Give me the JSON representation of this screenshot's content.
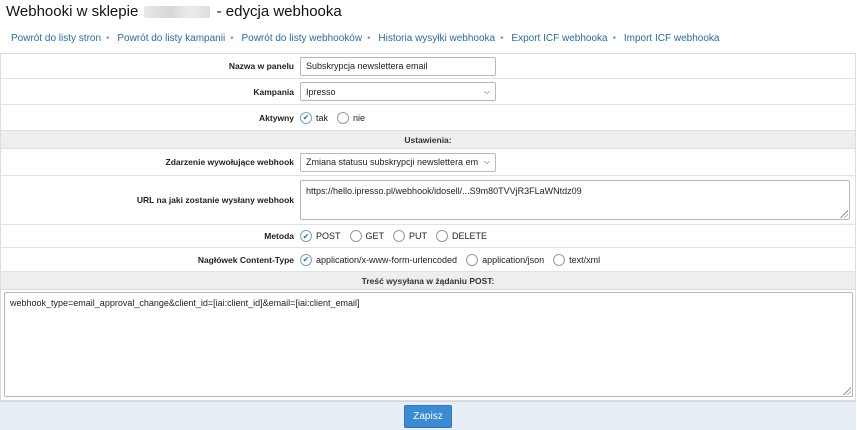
{
  "header": {
    "title_prefix": "Webhooki w sklepie",
    "title_suffix": "- edycja webhooka"
  },
  "nav": {
    "items": [
      "Powrót do listy stron",
      "Powrót do listy kampanii",
      "Powrót do listy webhooków",
      "Historia wysyłki webhooka",
      "Export ICF webhooka",
      "Import ICF webhooka"
    ]
  },
  "form": {
    "name_label": "Nazwa w panelu",
    "name_value": "Subskrypcja newslettera email",
    "campaign_label": "Kampania",
    "campaign_value": "Ipresso",
    "active_label": "Aktywny",
    "active_options": [
      "tak",
      "nie"
    ],
    "settings_header": "Ustawienia:",
    "event_label": "Zdarzenie wywołujące webhook",
    "event_value": "Zmiana statusu subskrypcji newslettera email",
    "url_label": "URL na jaki zostanie wysłany webhook",
    "url_value": "https://hello.ipresso.pl/webhook/idosell/...S9m80TVVjR3FLaWNtdz09",
    "method_label": "Metoda",
    "method_options": [
      "POST",
      "GET",
      "PUT",
      "DELETE"
    ],
    "content_type_label": "Nagłówek Content-Type",
    "content_type_options": [
      "application/x-www-form-urlencoded",
      "application/json",
      "text/xml"
    ],
    "body_header": "Treść wysyłana w żądaniu POST:",
    "body_value": "webhook_type=email_approval_change&client_id=[iai:client_id]&email=[iai:client_email]"
  },
  "footer": {
    "save_label": "Zapisz"
  },
  "selected": {
    "active": "tak",
    "method": "POST",
    "content_type": "application/x-www-form-urlencoded"
  },
  "colors": {
    "link": "#2a6aa8",
    "button": "#3a8ad4",
    "section_bg": "#eeeeee",
    "footer_bg": "#e7eef6"
  }
}
